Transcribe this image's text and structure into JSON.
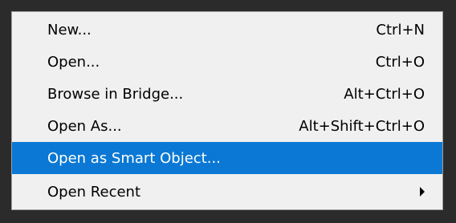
{
  "menu": {
    "items": [
      {
        "label": "New...",
        "shortcut": "Ctrl+N"
      },
      {
        "label": "Open...",
        "shortcut": "Ctrl+O"
      },
      {
        "label": "Browse in Bridge...",
        "shortcut": "Alt+Ctrl+O"
      },
      {
        "label": "Open As...",
        "shortcut": "Alt+Shift+Ctrl+O"
      },
      {
        "label": "Open as Smart Object...",
        "shortcut": "",
        "highlighted": true
      },
      {
        "label": "Open Recent",
        "shortcut": "",
        "has_submenu": true,
        "submenu_icon": "chevron-right-icon"
      }
    ]
  },
  "colors": {
    "background": "#2b2b2b",
    "menu_background": "#f0f0f0",
    "highlight": "#0a78d4",
    "highlight_text": "#ffffff",
    "text": "#000000"
  }
}
